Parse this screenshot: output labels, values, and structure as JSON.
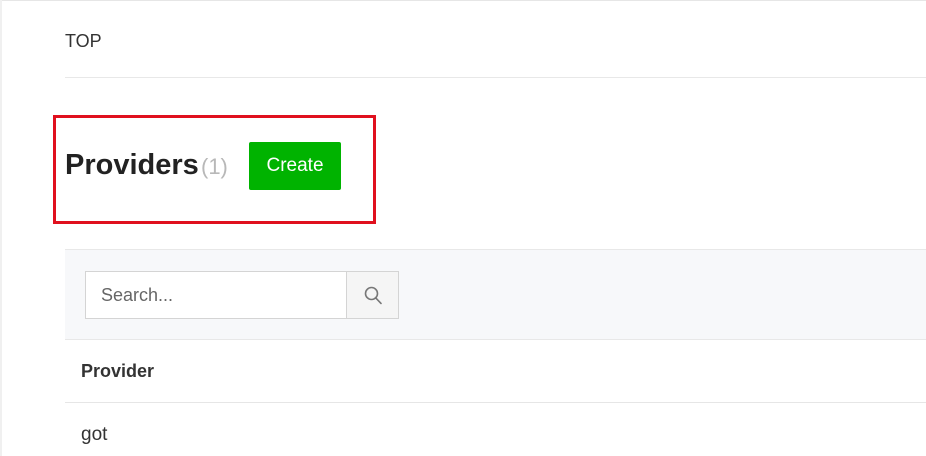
{
  "breadcrumb": {
    "label": "TOP"
  },
  "header": {
    "title": "Providers",
    "count": "(1)",
    "create_label": "Create"
  },
  "search": {
    "placeholder": "Search...",
    "value": "",
    "icon": "search-icon"
  },
  "table": {
    "columns": [
      "Provider"
    ],
    "rows": [
      [
        "got"
      ]
    ]
  },
  "colors": {
    "accent": "#00b300",
    "highlight": "#e0101e"
  }
}
